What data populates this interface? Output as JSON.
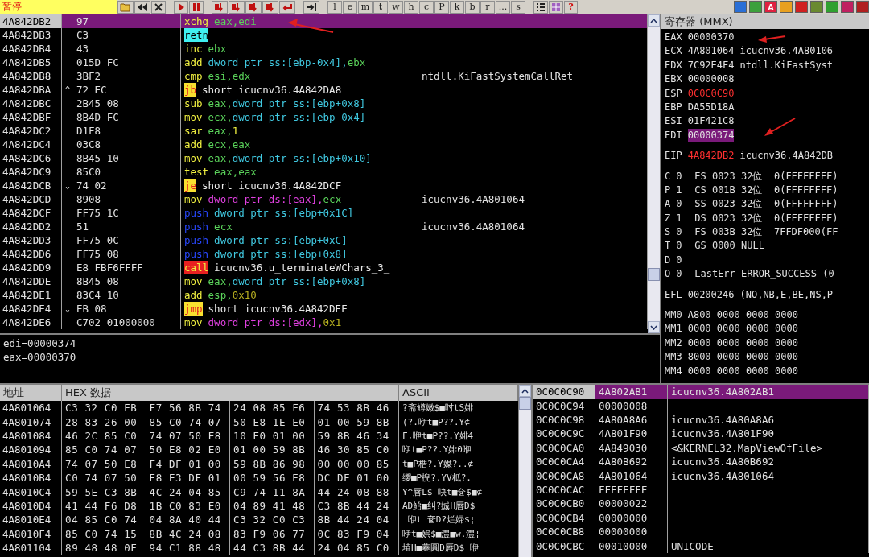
{
  "toolbar": {
    "status": "暂停",
    "letters": [
      "l",
      "e",
      "m",
      "t",
      "w",
      "h",
      "c",
      "P",
      "k",
      "b",
      "r",
      "...",
      "s"
    ],
    "help": "?",
    "font_button": "A"
  },
  "disassembly": {
    "rows": [
      {
        "address": "4A842DB2",
        "bytes": "97",
        "mnemonic": "xchg",
        "kind": "normal",
        "operands": [
          {
            "text": "eax,",
            "kind": "reg"
          },
          {
            "text": "edi",
            "kind": "reg"
          }
        ],
        "selected": true
      },
      {
        "address": "4A842DB3",
        "bytes": "C3",
        "mnemonic": "retn",
        "kind": "ret",
        "operands": [],
        "selected": false
      },
      {
        "address": "4A842DB4",
        "bytes": "43",
        "mnemonic": "inc",
        "kind": "normal",
        "operands": [
          {
            "text": "ebx",
            "kind": "reg"
          }
        ],
        "selected": false
      },
      {
        "address": "4A842DB5",
        "bytes": "015D FC",
        "mnemonic": "add",
        "kind": "normal",
        "operands": [
          {
            "text": "dword ptr ss:[ebp-0x4],",
            "kind": "mem"
          },
          {
            "text": "ebx",
            "kind": "reg"
          }
        ],
        "selected": false
      },
      {
        "address": "4A842DB8",
        "bytes": "3BF2",
        "mnemonic": "cmp",
        "kind": "normal",
        "operands": [
          {
            "text": "esi,",
            "kind": "reg"
          },
          {
            "text": "edx",
            "kind": "reg"
          }
        ],
        "comment": "ntdll.KiFastSystemCallRet",
        "selected": false
      },
      {
        "address": "4A842DBA",
        "mark": "^",
        "bytes": "72 EC",
        "mnemonic": "jb",
        "kind": "jump",
        "operands": [
          {
            "text": "short icucnv36.4A842DA8",
            "kind": "label"
          }
        ],
        "selected": false
      },
      {
        "address": "4A842DBC",
        "bytes": "2B45 08",
        "mnemonic": "sub",
        "kind": "normal",
        "operands": [
          {
            "text": "eax,",
            "kind": "reg"
          },
          {
            "text": "dword ptr ss:[ebp+0x8]",
            "kind": "mem"
          }
        ],
        "selected": false
      },
      {
        "address": "4A842DBF",
        "bytes": "8B4D FC",
        "mnemonic": "mov",
        "kind": "normal",
        "operands": [
          {
            "text": "ecx,",
            "kind": "reg"
          },
          {
            "text": "dword ptr ss:[ebp-0x4]",
            "kind": "mem"
          }
        ],
        "selected": false
      },
      {
        "address": "4A842DC2",
        "bytes": "D1F8",
        "mnemonic": "sar",
        "kind": "normal",
        "operands": [
          {
            "text": "eax,",
            "kind": "reg"
          },
          {
            "text": "1",
            "kind": "num"
          }
        ],
        "selected": false
      },
      {
        "address": "4A842DC4",
        "bytes": "03C8",
        "mnemonic": "add",
        "kind": "normal",
        "operands": [
          {
            "text": "ecx,",
            "kind": "reg"
          },
          {
            "text": "eax",
            "kind": "reg"
          }
        ],
        "selected": false
      },
      {
        "address": "4A842DC6",
        "bytes": "8B45 10",
        "mnemonic": "mov",
        "kind": "normal",
        "operands": [
          {
            "text": "eax,",
            "kind": "reg"
          },
          {
            "text": "dword ptr ss:[ebp+0x10]",
            "kind": "mem"
          }
        ],
        "selected": false
      },
      {
        "address": "4A842DC9",
        "bytes": "85C0",
        "mnemonic": "test",
        "kind": "normal",
        "operands": [
          {
            "text": "eax,",
            "kind": "reg"
          },
          {
            "text": "eax",
            "kind": "reg"
          }
        ],
        "selected": false
      },
      {
        "address": "4A842DCB",
        "mark": "⌄",
        "bytes": "74 02",
        "mnemonic": "je",
        "kind": "jump",
        "operands": [
          {
            "text": "short icucnv36.4A842DCF",
            "kind": "label"
          }
        ],
        "selected": false
      },
      {
        "address": "4A842DCD",
        "bytes": "8908",
        "mnemonic": "mov",
        "kind": "normal",
        "operands": [
          {
            "text": "dword ptr ds:[eax],",
            "kind": "dsmem"
          },
          {
            "text": "ecx",
            "kind": "reg"
          }
        ],
        "comment": "icucnv36.4A801064",
        "selected": false
      },
      {
        "address": "4A842DCF",
        "bytes": "FF75 1C",
        "mnemonic": "push",
        "kind": "push",
        "operands": [
          {
            "text": "dword ptr ss:[ebp+0x1C]",
            "kind": "mem"
          }
        ],
        "selected": false
      },
      {
        "address": "4A842DD2",
        "bytes": "51",
        "mnemonic": "push",
        "kind": "push",
        "operands": [
          {
            "text": "ecx",
            "kind": "reg"
          }
        ],
        "comment": "icucnv36.4A801064",
        "selected": false
      },
      {
        "address": "4A842DD3",
        "bytes": "FF75 0C",
        "mnemonic": "push",
        "kind": "push",
        "operands": [
          {
            "text": "dword ptr ss:[ebp+0xC]",
            "kind": "mem"
          }
        ],
        "selected": false
      },
      {
        "address": "4A842DD6",
        "bytes": "FF75 08",
        "mnemonic": "push",
        "kind": "push",
        "operands": [
          {
            "text": "dword ptr ss:[ebp+0x8]",
            "kind": "mem"
          }
        ],
        "selected": false
      },
      {
        "address": "4A842DD9",
        "bytes": "E8 FBF6FFFF",
        "mnemonic": "call",
        "kind": "call",
        "operands": [
          {
            "text": "icucnv36.u_terminateWChars_3_",
            "kind": "label"
          }
        ],
        "selected": false
      },
      {
        "address": "4A842DDE",
        "bytes": "8B45 08",
        "mnemonic": "mov",
        "kind": "normal",
        "operands": [
          {
            "text": "eax,",
            "kind": "reg"
          },
          {
            "text": "dword ptr ss:[ebp+0x8]",
            "kind": "mem"
          }
        ],
        "selected": false
      },
      {
        "address": "4A842DE1",
        "bytes": "83C4 10",
        "mnemonic": "add",
        "kind": "normal",
        "operands": [
          {
            "text": "esp,",
            "kind": "reg"
          },
          {
            "text": "0x10",
            "kind": "imm"
          }
        ],
        "selected": false
      },
      {
        "address": "4A842DE4",
        "mark": "⌄",
        "bytes": "EB 08",
        "mnemonic": "jmp",
        "kind": "jump",
        "operands": [
          {
            "text": "short icucnv36.4A842DEE",
            "kind": "label"
          }
        ],
        "selected": false
      },
      {
        "address": "4A842DE6",
        "bytes": "C702 01000000",
        "mnemonic": "mov",
        "kind": "normal",
        "operands": [
          {
            "text": "dword ptr ds:[edx],",
            "kind": "dsmem"
          },
          {
            "text": "0x1",
            "kind": "imm"
          }
        ],
        "selected": false
      }
    ]
  },
  "info": [
    "edi=00000374",
    "eax=00000370"
  ],
  "registers": {
    "title": "寄存器 (MMX)",
    "general": [
      {
        "name": "EAX",
        "value": "00000370",
        "changed": false,
        "selected": false
      },
      {
        "name": "ECX",
        "value": "4A801064",
        "comment": "icucnv36.4A80106",
        "changed": false,
        "selected": false
      },
      {
        "name": "EDX",
        "value": "7C92E4F4",
        "comment": "ntdll.KiFastSyst",
        "changed": false,
        "selected": false
      },
      {
        "name": "EBX",
        "value": "00000008",
        "changed": false,
        "selected": false
      },
      {
        "name": "ESP",
        "value": "0C0C0C90",
        "changed": true,
        "selected": false
      },
      {
        "name": "EBP",
        "value": "DA55D18A",
        "changed": false,
        "selected": false
      },
      {
        "name": "ESI",
        "value": "01F421C8",
        "changed": false,
        "selected": false
      },
      {
        "name": "EDI",
        "value": "00000374",
        "changed": false,
        "selected": true
      }
    ],
    "eip": {
      "name": "EIP",
      "value": "4A842DB2",
      "comment": "icucnv36.4A842DB",
      "changed": true,
      "selected": false
    },
    "flags": [
      {
        "name": "C",
        "bit": "0",
        "detail": "ES 0023 32位  0(FFFFFFFF)"
      },
      {
        "name": "P",
        "bit": "1",
        "detail": "CS 001B 32位  0(FFFFFFFF)"
      },
      {
        "name": "A",
        "bit": "0",
        "detail": "SS 0023 32位  0(FFFFFFFF)"
      },
      {
        "name": "Z",
        "bit": "1",
        "detail": "DS 0023 32位  0(FFFFFFFF)"
      },
      {
        "name": "S",
        "bit": "0",
        "detail": "FS 003B 32位  7FFDF000(FF"
      },
      {
        "name": "T",
        "bit": "0",
        "detail": "GS 0000 NULL"
      },
      {
        "name": "D",
        "bit": "0"
      },
      {
        "name": "O",
        "bit": "0",
        "detail": "LastErr ERROR_SUCCESS (0"
      }
    ],
    "efl": {
      "name": "EFL",
      "value": "00200246",
      "comment": "(NO,NB,E,BE,NS,P"
    },
    "mmx": [
      {
        "name": "MM0",
        "value": "A800 0000 0000 0000"
      },
      {
        "name": "MM1",
        "value": "0000 0000 0000 0000"
      },
      {
        "name": "MM2",
        "value": "0000 0000 0000 0000"
      },
      {
        "name": "MM3",
        "value": "8000 0000 0000 0000"
      },
      {
        "name": "MM4",
        "value": "0000 0000 0000 0000"
      }
    ]
  },
  "dump": {
    "columns": [
      "地址",
      "HEX 数据",
      "ASCII"
    ],
    "rows": [
      {
        "address": "4A801064",
        "hex": [
          "C3 32 C0 EB",
          "F7 56 8B 74",
          "24 08 85 F6",
          "74 53 8B 46"
        ],
        "ascii": "?斋鳟嫩$■吋tS婔"
      },
      {
        "address": "4A801074",
        "hex": [
          "28 83 26 00",
          "85 C0 74 07",
          "50 E8 1E E0",
          "01 00 59 8B"
        ],
        "ascii": "(?.咿t■P??.Y⊄"
      },
      {
        "address": "4A801084",
        "hex": [
          "46 2C 85 C0",
          "74 07 50 E8",
          "10 E0 01 00",
          "59 8B 46 34"
        ],
        "ascii": "F,咿t■P??.Y婔4"
      },
      {
        "address": "4A801094",
        "hex": [
          "85 C0 74 07",
          "50 E8 02 E0",
          "01 00 59 8B",
          "46 30 85 C0"
        ],
        "ascii": "咿t■P??.Y婔0咿"
      },
      {
        "address": "4A8010A4",
        "hex": [
          "74 07 50 E8",
          "F4 DF 01 00",
          "59 8B 86 98",
          "00 00 00 85"
        ],
        "ascii": "t■P梏?.Y媒?..⊄"
      },
      {
        "address": "4A8010B4",
        "hex": [
          "C0 74 07 50",
          "E8 E3 DF 01",
          "00 59 56 E8",
          "DC DF 01 00"
        ],
        "ascii": "缨■P棿?.YV柢?."
      },
      {
        "address": "4A8010C4",
        "hex": [
          "59 5E C3 8B",
          "4C 24 04 85",
          "C9 74 11 8A",
          "44 24 08 88"
        ],
        "ascii": "Y^唇L$ 吷t■奁$■⊄"
      },
      {
        "address": "4A8010D4",
        "hex": [
          "41 44 F6 D8",
          "1B C0 83 E0",
          "04 89 41 48",
          "C3 8B 44 24"
        ],
        "ascii": "AD鲐■纠?娍H唇D$"
      },
      {
        "address": "4A8010E4",
        "hex": [
          "04 85 C0 74",
          "04 8A 40 44",
          "C3 32 C0 C3",
          "8B 44 24 04"
        ],
        "ascii": " 咿t 奁D?烂婦$¦"
      },
      {
        "address": "4A8010F4",
        "hex": [
          "85 C0 74 15",
          "8B 4C 24 08",
          "83 F9 06 77",
          "0C 83 F9 04"
        ],
        "ascii": "咿t■娯$■澧■w.澧¦"
      },
      {
        "address": "4A801104",
        "hex": [
          "89 48 48 0F",
          "94 C1 88 48",
          "44 C3 8B 44",
          "24 04 85 C0"
        ],
        "ascii": "埴H■蓁圓D唇D$ 咿"
      }
    ]
  },
  "stack": {
    "rows": [
      {
        "address": "0C0C0C90",
        "value": "4A802AB1",
        "comment": "icucnv36.4A802AB1",
        "selected": true
      },
      {
        "address": "0C0C0C94",
        "value": "00000008",
        "selected": false
      },
      {
        "address": "0C0C0C98",
        "value": "4A80A8A6",
        "comment": "icucnv36.4A80A8A6",
        "selected": false
      },
      {
        "address": "0C0C0C9C",
        "value": "4A801F90",
        "comment": "icucnv36.4A801F90",
        "selected": false
      },
      {
        "address": "0C0C0CA0",
        "value": "4A849030",
        "comment": "<&KERNEL32.MapViewOfFile>",
        "selected": false
      },
      {
        "address": "0C0C0CA4",
        "value": "4A80B692",
        "comment": "icucnv36.4A80B692",
        "selected": false
      },
      {
        "address": "0C0C0CA8",
        "value": "4A801064",
        "comment": "icucnv36.4A801064",
        "selected": false
      },
      {
        "address": "0C0C0CAC",
        "value": "FFFFFFFF",
        "selected": false
      },
      {
        "address": "0C0C0CB0",
        "value": "00000022",
        "selected": false
      },
      {
        "address": "0C0C0CB4",
        "value": "00000000",
        "selected": false
      },
      {
        "address": "0C0C0CB8",
        "value": "00000000",
        "selected": false
      },
      {
        "address": "0C0C0CBC",
        "value": "00010000",
        "comment": "UNICODE",
        "selected": false
      }
    ]
  }
}
